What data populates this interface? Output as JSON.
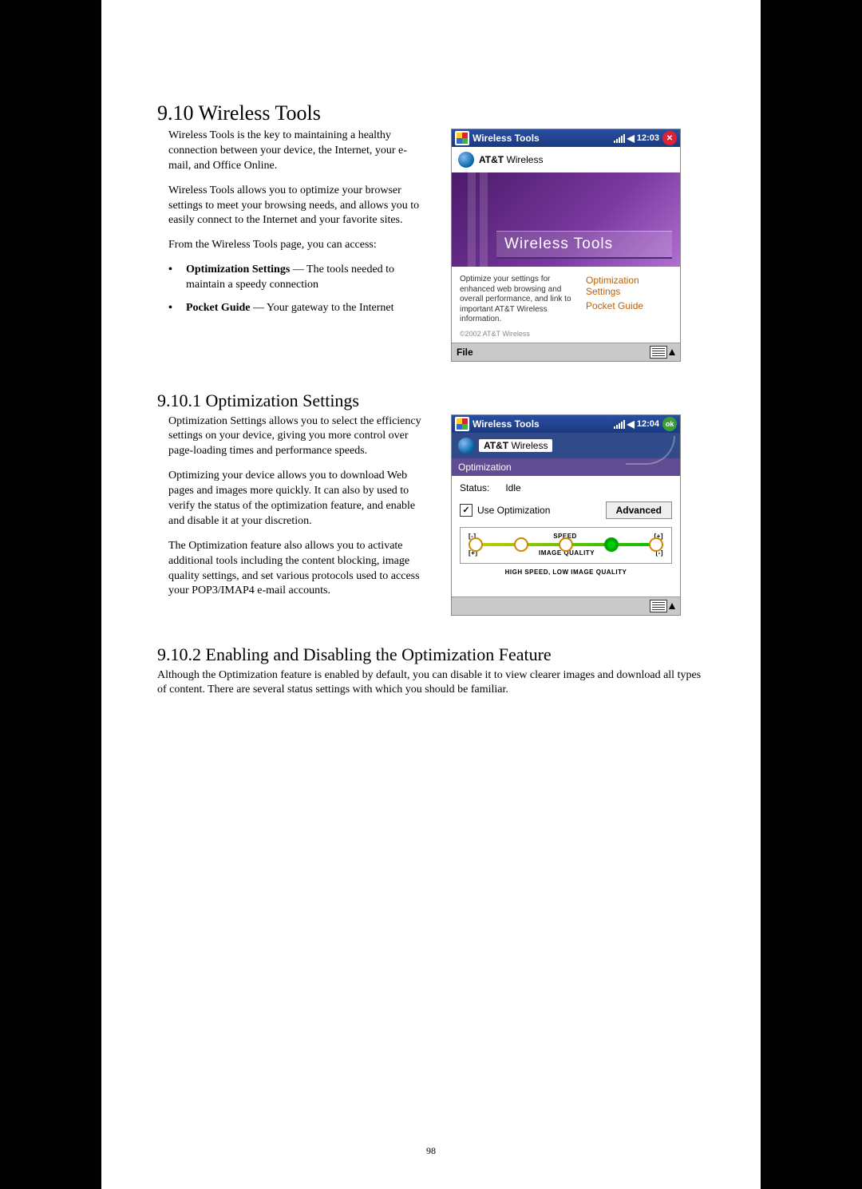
{
  "section1": {
    "heading": "9.10 Wireless Tools",
    "p1": "Wireless Tools is the key to maintaining a healthy connection between your device, the Internet, your e-mail, and Office Online.",
    "p2": "Wireless Tools allows you to optimize your browser settings to meet your browsing needs, and allows you to easily connect to the Internet and your favorite sites.",
    "p3": "From the Wireless Tools page, you can access:",
    "bullets": [
      {
        "term": "Optimization Settings",
        "rest": " — The tools needed to maintain a speedy connection"
      },
      {
        "term": "Pocket Guide",
        "rest": " — Your gateway to the Internet"
      }
    ]
  },
  "device1": {
    "title": "Wireless Tools",
    "time": "12:03",
    "brand_bold": "AT&T",
    "brand_rest": " Wireless",
    "banner_text": "Wireless Tools",
    "blurb": "Optimize your settings for enhanced web browsing and overall performance, and link to important AT&T Wireless information.",
    "link1": "Optimization Settings",
    "link2": "Pocket Guide",
    "copy": "©2002 AT&T Wireless",
    "menu_file": "File"
  },
  "section2": {
    "heading": "9.10.1  Optimization Settings",
    "p1": "Optimization Settings allows you to select the efficiency settings on your device, giving you more control over page-loading times and performance speeds.",
    "p2": "Optimizing your device allows you to download Web pages and images more quickly. It can also by used to verify the status of the optimization feature, and enable and disable it at your discretion.",
    "p3": "The Optimization feature also allows you to activate additional tools including the content blocking, image quality settings, and set various protocols used to access your POP3/IMAP4 e-mail accounts."
  },
  "device2": {
    "title": "Wireless Tools",
    "time": "12:04",
    "ok": "ok",
    "brand_bold": "AT&T",
    "brand_rest": " Wireless",
    "section_label": "Optimization",
    "status_label": "Status:",
    "status_value": "Idle",
    "checkbox_label": "Use Optimization",
    "advanced": "Advanced",
    "minus": "[-]",
    "plus": "[+]",
    "speed": "SPEED",
    "quality": "IMAGE QUALITY",
    "caption": "HIGH SPEED, LOW IMAGE QUALITY"
  },
  "section3": {
    "heading": "9.10.2  Enabling and Disabling the Optimization Feature",
    "p1": "Although the Optimization feature is enabled by default, you can disable it to view clearer images and download all types of content. There are several status settings with which you should be familiar."
  },
  "page_number": "98"
}
